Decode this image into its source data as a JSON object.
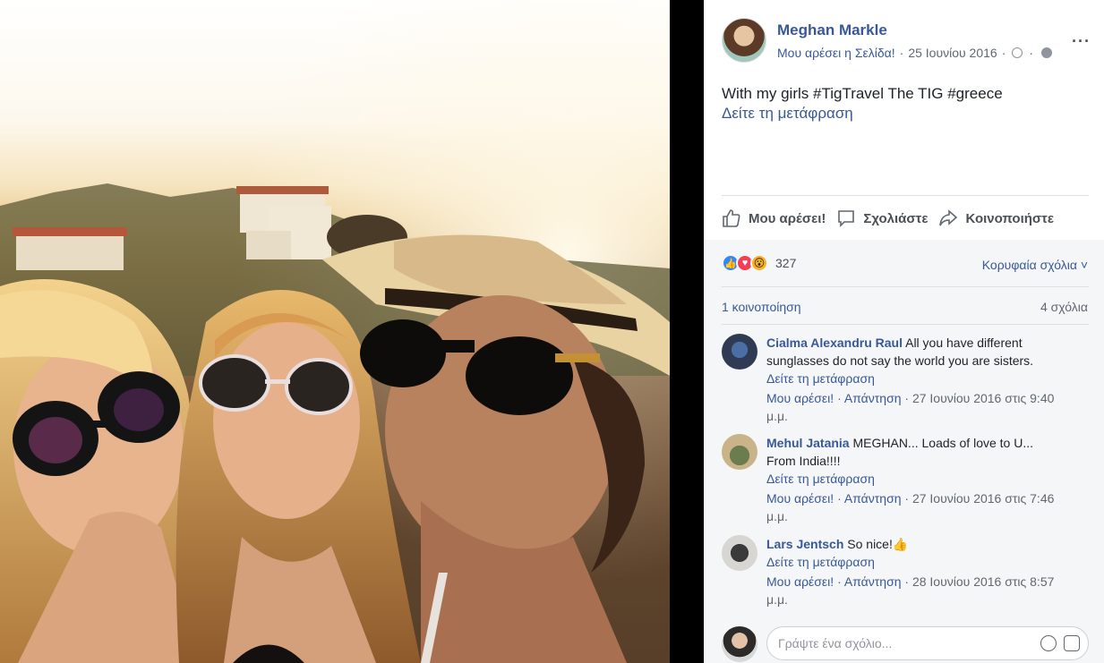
{
  "post": {
    "page_name": "Meghan Markle",
    "like_page": "Μου αρέσει η Σελίδα!",
    "date": "25 Ιουνίου 2016",
    "separator": "·",
    "more": "···",
    "text": "With my girls #TigTravel The TIG #greece",
    "see_translation": "Δείτε τη μετάφραση"
  },
  "actions": {
    "like": "Μου αρέσει!",
    "comment": "Σχολιάστε",
    "share": "Κοινοποιήστε"
  },
  "stats": {
    "reaction_count": "327",
    "top_comments": "Κορυφαία σχόλια ˅",
    "shares": "1 κοινοποίηση",
    "comments": "4 σχόλια"
  },
  "comments": [
    {
      "author": "Cialma Alexandru Raul",
      "text": " All you have different sunglasses do not say the world you are sisters.",
      "translation": "Δείτε τη μετάφραση",
      "like": "Μου αρέσει!",
      "reply": "Απάντηση",
      "time": "27 Ιουνίου 2016 στις 9:40 μ.μ."
    },
    {
      "author": "Mehul Jatania",
      "text": " MEGHAN... Loads of love to U... From India!!!!",
      "translation": "Δείτε τη μετάφραση",
      "like": "Μου αρέσει!",
      "reply": "Απάντηση",
      "time": "27 Ιουνίου 2016 στις 7:46 μ.μ."
    },
    {
      "author": "Lars Jentsch",
      "text": " So nice!👍",
      "translation": "Δείτε τη μετάφραση",
      "like": "Μου αρέσει!",
      "reply": "Απάντηση",
      "time": "28 Ιουνίου 2016 στις 8:57 μ.μ."
    }
  ],
  "composer": {
    "placeholder": "Γράψτε ένα σχόλιο..."
  },
  "colors": {
    "link": "#385898",
    "like_reaction": "#2d88ff",
    "love_reaction": "#f33e58",
    "wow_reaction": "#f7b125"
  },
  "icons": [
    "like-icon",
    "comment-icon",
    "share-icon",
    "clock-icon",
    "globe-icon",
    "emoji-icon",
    "sticker-icon"
  ]
}
